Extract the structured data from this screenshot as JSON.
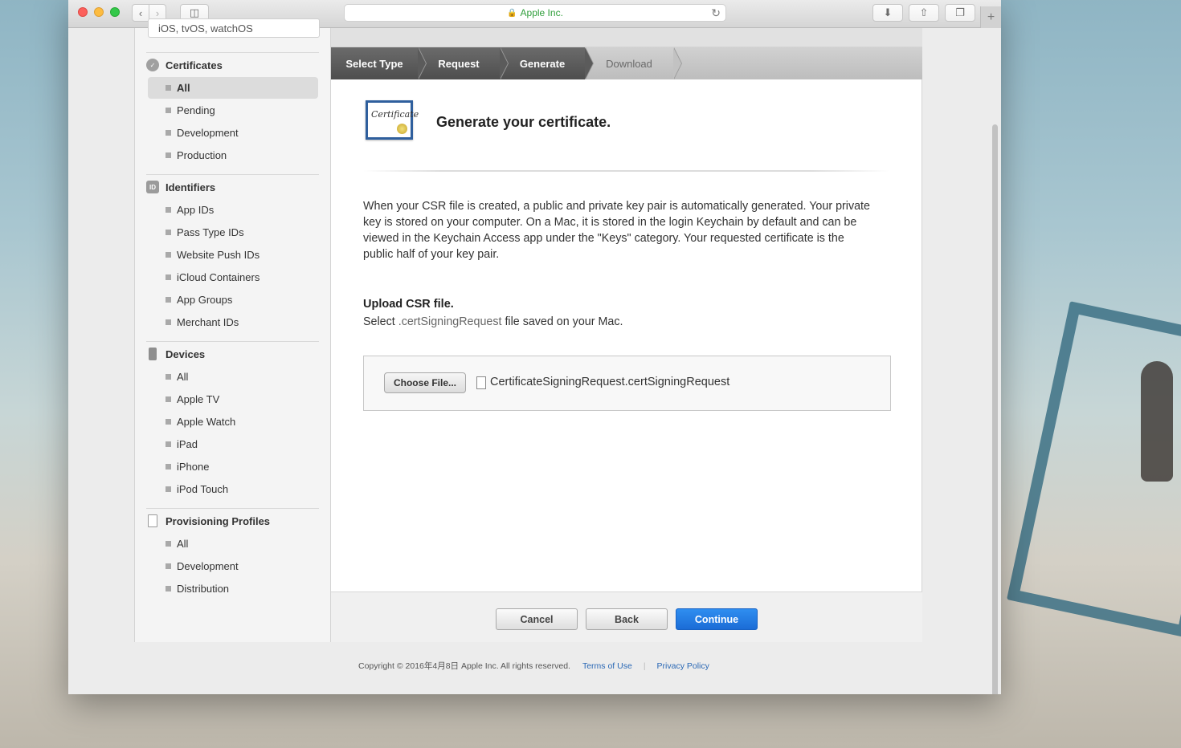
{
  "browser": {
    "address": "Apple Inc.",
    "new_tab": "+"
  },
  "sidebar": {
    "platform_select": "iOS, tvOS, watchOS",
    "sections": [
      {
        "title": "Certificates",
        "icon": "certificate-badge-icon",
        "items": [
          "All",
          "Pending",
          "Development",
          "Production"
        ]
      },
      {
        "title": "Identifiers",
        "icon_text": "ID",
        "items": [
          "App IDs",
          "Pass Type IDs",
          "Website Push IDs",
          "iCloud Containers",
          "App Groups",
          "Merchant IDs"
        ]
      },
      {
        "title": "Devices",
        "icon": "device-icon",
        "items": [
          "All",
          "Apple TV",
          "Apple Watch",
          "iPad",
          "iPhone",
          "iPod Touch"
        ]
      },
      {
        "title": "Provisioning Profiles",
        "icon": "document-icon",
        "items": [
          "All",
          "Development",
          "Distribution"
        ]
      }
    ],
    "active_item": "Certificates/All"
  },
  "steps": [
    "Select Type",
    "Request",
    "Generate",
    "Download"
  ],
  "current_step": "Generate",
  "main": {
    "cert_script": "Certificate",
    "title": "Generate your certificate.",
    "description": "When your CSR file is created, a public and private key pair is automatically generated. Your private key is stored on your computer. On a Mac, it is stored in the login Keychain by default and can be viewed in the Keychain Access app under the \"Keys\" category. Your requested certificate is the public half of your key pair.",
    "upload_title": "Upload CSR file.",
    "upload_sub_prefix": "Select ",
    "upload_sub_ext": ".certSigningRequest",
    "upload_sub_suffix": " file saved on your Mac.",
    "choose_file_label": "Choose File...",
    "file_name": "CertificateSigningRequest.certSigningRequest"
  },
  "buttons": {
    "cancel": "Cancel",
    "back": "Back",
    "continue": "Continue"
  },
  "footer": {
    "copyright": "Copyright © 2016年4月8日 Apple Inc. All rights reserved.",
    "terms": "Terms of Use",
    "privacy": "Privacy Policy",
    "separator": "|"
  },
  "colors": {
    "accent_blue": "#1b6cd6",
    "link": "#2a68b5",
    "secure_green": "#2f9e3a"
  }
}
